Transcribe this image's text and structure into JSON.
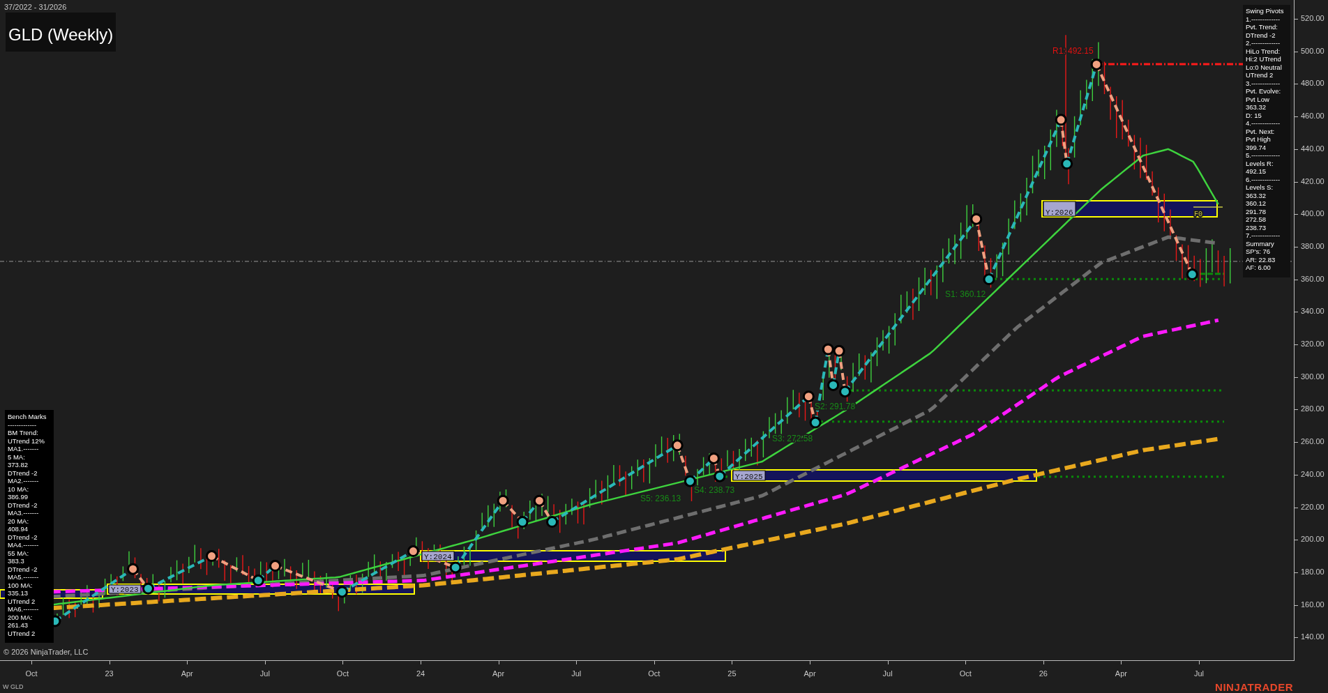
{
  "header": {
    "date_range": "37/2022 - 31/2026",
    "title": "GLD (Weekly)"
  },
  "swing_pivots": {
    "lines": [
      "Swing Pivots",
      "1.-------------",
      "Pvt. Trend:",
      "DTrend -2",
      "2.-------------",
      "HiLo Trend:",
      "Hi:2 UTrend",
      "Lo:0 Neutral",
      "UTrend 2",
      "3.-------------",
      "Pvt. Evolve:",
      "Pvt Low",
      "363.32",
      "D: 15",
      "4.-------------",
      "Pvt. Next:",
      "Pvt High",
      "399.74",
      "5.-------------",
      "Levels R:",
      "492.15",
      "6.-------------",
      "Levels S:",
      "363.32",
      "360.12",
      "291.78",
      "272.58",
      "238.73",
      "7.-------------",
      "Summary",
      "SP's: 76",
      "AR: 22.83",
      "AF: 6.00"
    ]
  },
  "bench_marks": {
    "lines": [
      "Bench Marks",
      "-------------",
      "BM Trend:",
      "UTrend 12%",
      "MA1.-------",
      "5 MA:",
      "373.82",
      "DTrend -2",
      "MA2.-------",
      "10 MA:",
      "386.99",
      "DTrend -2",
      "MA3.-------",
      "20 MA:",
      "408.94",
      "DTrend -2",
      "MA4.-------",
      "55 MA:",
      "383.3",
      "DTrend -2",
      "MA5.-------",
      "100 MA:",
      "335.13",
      "UTrend 2",
      "MA6.-------",
      "200 MA:",
      "261.43",
      "UTrend 2"
    ]
  },
  "level_labels": [
    {
      "text": "R1: 492.15",
      "kind": "resistance"
    },
    {
      "text": "S1: 360.12",
      "kind": "support"
    },
    {
      "text": "S2: 291.78",
      "kind": "support"
    },
    {
      "text": "S3: 272.58",
      "kind": "support"
    },
    {
      "text": "S4: 238.73",
      "kind": "support"
    },
    {
      "text": "S5: 236.13",
      "kind": "support"
    }
  ],
  "year_boxes": [
    {
      "label": "Y:2023"
    },
    {
      "label": "Y:2024"
    },
    {
      "label": "Y:2025"
    },
    {
      "label": "Y:2026"
    }
  ],
  "fib_label": "F0",
  "y_axis": {
    "ticks": [
      "520.00",
      "500.00",
      "480.00",
      "460.00",
      "440.00",
      "420.00",
      "400.00",
      "380.00",
      "360.00",
      "340.00",
      "320.00",
      "300.00",
      "280.00",
      "260.00",
      "240.00",
      "220.00",
      "200.00",
      "180.00",
      "160.00",
      "140.00"
    ]
  },
  "x_axis": {
    "ticks": [
      "Oct",
      "23",
      "Apr",
      "Jul",
      "Oct",
      "24",
      "Apr",
      "Jul",
      "Oct",
      "25",
      "Apr",
      "Jul",
      "Oct",
      "26",
      "Apr",
      "Jul"
    ]
  },
  "copyright": "© 2026 NinjaTrader, LLC",
  "instrument": "W GLD",
  "brand": "NINJATRADER"
}
